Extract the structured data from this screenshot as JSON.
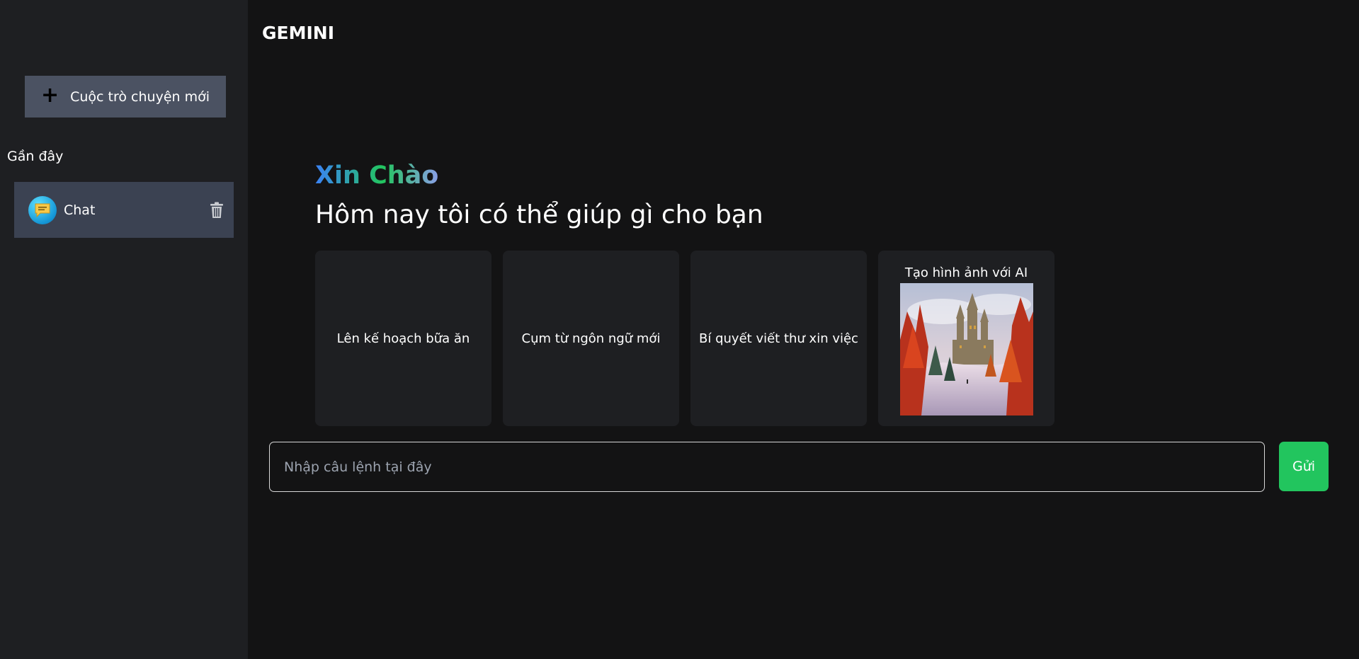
{
  "header": {
    "brand": "GEMINI"
  },
  "sidebar": {
    "new_chat_label": "Cuộc trò chuyện mới",
    "new_chat_icon": "plus-icon",
    "recent_label": "Gần đây",
    "chats": [
      {
        "label": "Chat",
        "icon": "chat-bubble-icon",
        "action_icon": "trash-icon"
      }
    ]
  },
  "main": {
    "greeting": "Xin Chào",
    "subtitle": "Hôm nay tôi có thể giúp gì cho bạn",
    "cards": [
      {
        "label": "Lên kế hoạch bữa ăn"
      },
      {
        "label": "Cụm từ ngôn ngữ mới"
      },
      {
        "label": "Bí quyết viết thư xin việc"
      },
      {
        "label": "Tạo hình ảnh với AI",
        "image": "winter-castle-image"
      }
    ]
  },
  "prompt": {
    "placeholder": "Nhập câu lệnh tại đây",
    "value": "",
    "send_label": "Gửi"
  },
  "colors": {
    "background": "#131314",
    "sidebar": "#1e1f22",
    "accent_green": "#22c55e",
    "new_chat_button": "#4b5262",
    "chat_item": "#3b4252"
  }
}
